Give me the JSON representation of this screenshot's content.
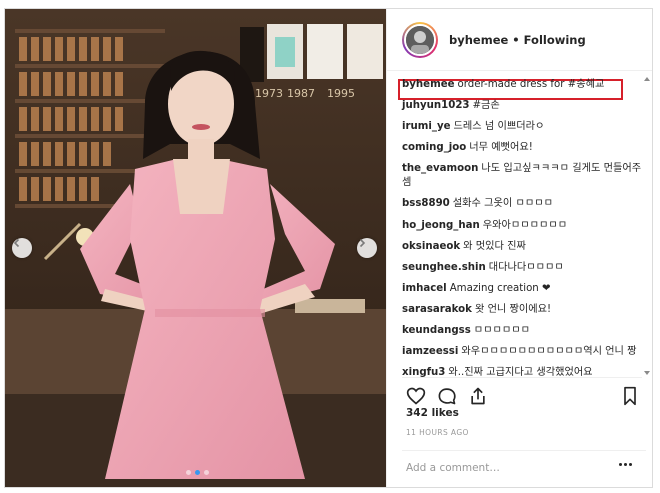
{
  "post": {
    "username": "byhemee",
    "separator": "•",
    "follow_status": "Following",
    "photo": {
      "subject": "woman in pink dress",
      "shelf_labels": [
        "1973",
        "1987",
        "1995"
      ],
      "carousel_dots": 3,
      "active_dot": 1
    },
    "caption": {
      "user": "byhemee",
      "text": "order-made dress for #송혜교"
    },
    "comments": [
      {
        "user": "juhyun1023",
        "text": "#금손"
      },
      {
        "user": "irumi_ye",
        "text": "드레스 넘 이쁘더라ㅇ"
      },
      {
        "user": "coming_joo",
        "text": "너무 예뻣어요!"
      },
      {
        "user": "the_evamoon",
        "text": "나도 입고싶ㅋㅋㅋㅁ 길게도 먼들어주셈"
      },
      {
        "user": "bss8890",
        "text": "설화수 그옷이 ㅁㅁㅁㅁ"
      },
      {
        "user": "ho_jeong_han",
        "text": "우와아ㅁㅁㅁㅁㅁㅁ"
      },
      {
        "user": "oksinaeok",
        "text": "와 멋있다 진짜"
      },
      {
        "user": "seunghee.shin",
        "text": "대다나다ㅁㅁㅁㅁ"
      },
      {
        "user": "imhacel",
        "text": "Amazing creation ❤"
      },
      {
        "user": "sarasarakok",
        "text": "왓 언니 짱이에요!"
      },
      {
        "user": "keundangss",
        "text": "ㅁㅁㅁㅁㅁㅁ"
      },
      {
        "user": "iamzeessi",
        "text": "와우ㅁㅁㅁㅁㅁㅁㅁㅁㅁㅁㅁ역시 언니 짱"
      },
      {
        "user": "xingfu3",
        "text": "와..진짜 고급지다고 생각했었어요"
      }
    ],
    "likes": "342 likes",
    "time_ago": "11 HOURS AGO",
    "add_comment_placeholder": "Add a comment…",
    "icons": {
      "like": "heart-icon",
      "comment": "comment-bubble-icon",
      "share": "share-icon",
      "save": "bookmark-icon",
      "more": "ellipsis-icon"
    },
    "colors": {
      "highlight_border": "#d6202a",
      "dress": "#f0a9b6",
      "carousel_active": "#3897f0"
    }
  }
}
